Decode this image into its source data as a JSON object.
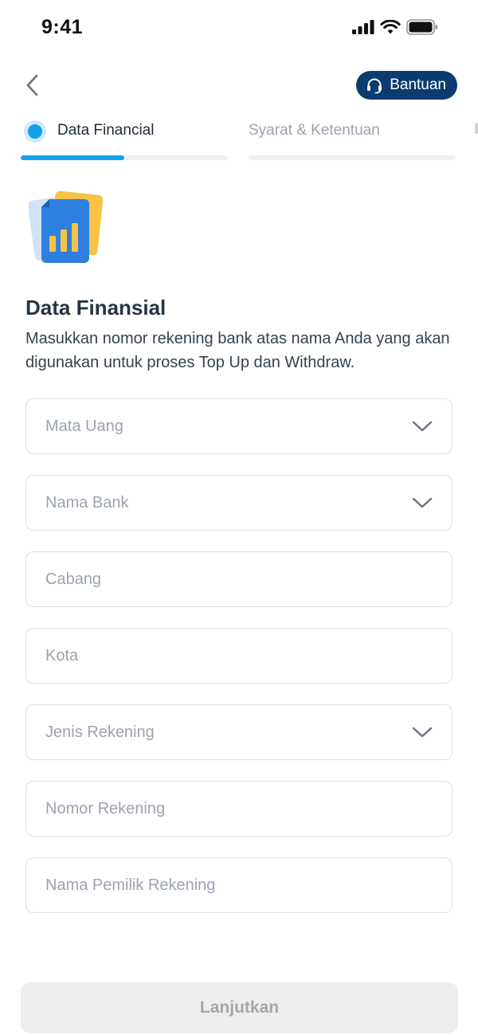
{
  "status_bar": {
    "time": "9:41"
  },
  "header": {
    "help_label": "Bantuan"
  },
  "stepper": {
    "steps": [
      {
        "label": "Data Financial",
        "active": true,
        "progress": 0.5
      },
      {
        "label": "Syarat & Ketentuan",
        "active": false,
        "progress": 0
      }
    ]
  },
  "content": {
    "title": "Data Finansial",
    "description": "Masukkan nomor rekening bank atas nama Anda yang akan digunakan untuk proses Top Up dan Withdraw."
  },
  "form": {
    "fields": [
      {
        "placeholder": "Mata Uang",
        "type": "select"
      },
      {
        "placeholder": "Nama Bank",
        "type": "select"
      },
      {
        "placeholder": "Cabang",
        "type": "text"
      },
      {
        "placeholder": "Kota",
        "type": "text"
      },
      {
        "placeholder": "Jenis Rekening",
        "type": "select"
      },
      {
        "placeholder": "Nomor Rekening",
        "type": "text"
      },
      {
        "placeholder": "Nama Pemilik Rekening",
        "type": "text"
      }
    ],
    "submit_label": "Lanjutkan"
  },
  "colors": {
    "primary": "#14a0e8",
    "help_button": "#0b3b6f",
    "disabled_button": "#eeeeef"
  }
}
